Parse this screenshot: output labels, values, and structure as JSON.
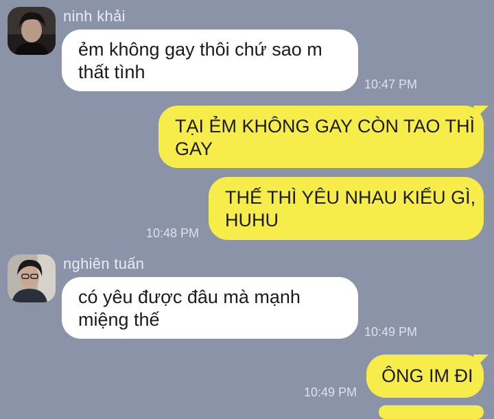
{
  "messages": [
    {
      "sender": "ninh khải",
      "lines": [
        "ẻm không gay thôi chứ sao m",
        "thất tình"
      ],
      "time": "10:47 PM"
    },
    {
      "lines": [
        "TẠI ẺM KHÔNG GAY CÒN TAO THÌ",
        "GAY"
      ]
    },
    {
      "lines": [
        "THẾ THÌ YÊU NHAU KIỂU GÌ,",
        "HUHU"
      ],
      "time": "10:48 PM"
    },
    {
      "sender": "nghiên tuấn",
      "lines": [
        "có yêu được đâu mà mạnh",
        "miệng thế"
      ],
      "time": "10:49 PM"
    },
    {
      "lines": [
        "ÔNG IM ĐI"
      ],
      "time": "10:49 PM"
    }
  ],
  "colors": {
    "background": "#8a93a7",
    "incoming_bubble": "#ffffff",
    "outgoing_bubble": "#f6ed4a"
  }
}
